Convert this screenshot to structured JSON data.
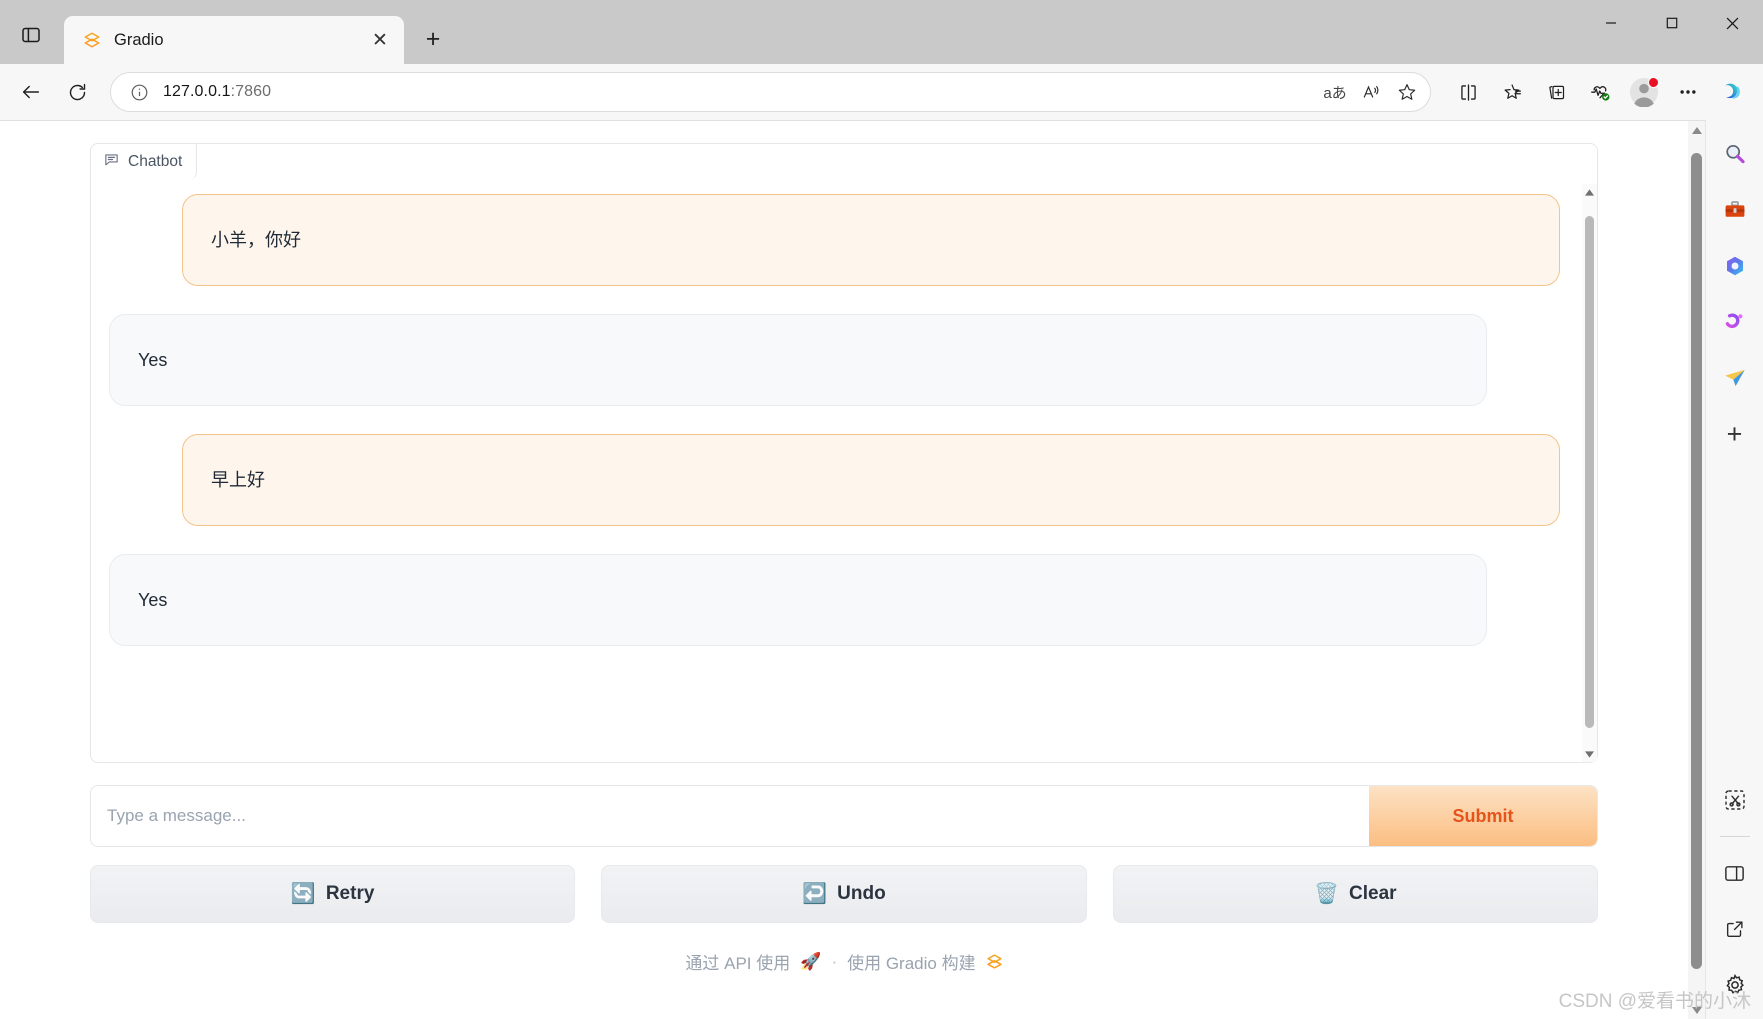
{
  "browser": {
    "tab": {
      "title": "Gradio",
      "favicon_icon": "gradio-logo-icon",
      "close_icon": "close-icon"
    },
    "new_tab_label": "+",
    "tab_sidebar_icon": "tab-sidebar-icon",
    "window_controls": {
      "minimize": "minimize-icon",
      "maximize": "maximize-icon",
      "close": "close-icon"
    },
    "nav": {
      "back_icon": "back-arrow-icon",
      "refresh_icon": "refresh-icon"
    },
    "omnibox": {
      "info_icon": "info-circle-icon",
      "url_host": "127.0.0.1",
      "url_port": ":7860",
      "actions": [
        {
          "name": "translate-icon",
          "glyph": "aあ"
        },
        {
          "name": "read-aloud-icon",
          "glyph": "A"
        },
        {
          "name": "favorite-star-icon",
          "glyph": "star"
        }
      ]
    },
    "toolbar_right": [
      {
        "name": "split-screen-icon"
      },
      {
        "name": "favorites-list-icon"
      },
      {
        "name": "collections-icon"
      },
      {
        "name": "browser-essentials-icon"
      },
      {
        "name": "profile-avatar"
      },
      {
        "name": "settings-and-more-icon"
      },
      {
        "name": "copilot-icon"
      }
    ],
    "rail": [
      {
        "name": "rail-search-icon",
        "glyph": "🔍"
      },
      {
        "name": "rail-tools-icon",
        "glyph": "🧰"
      },
      {
        "name": "rail-office-icon",
        "glyph": "🔷"
      },
      {
        "name": "rail-games-icon",
        "glyph": "🪄"
      },
      {
        "name": "rail-outlook-icon",
        "glyph": "📨"
      },
      {
        "name": "rail-add-icon",
        "glyph": "+"
      }
    ],
    "rail_bottom": [
      {
        "name": "rail-screenshot-icon",
        "glyph": "✂"
      },
      {
        "name": "rail-sidebar-toggle-icon",
        "glyph": "▯"
      },
      {
        "name": "rail-open-external-icon",
        "glyph": "↗"
      },
      {
        "name": "rail-settings-icon",
        "glyph": "⚙"
      }
    ]
  },
  "app": {
    "chatbot": {
      "label": "Chatbot",
      "label_icon": "chat-bubble-icon",
      "messages": [
        {
          "role": "user",
          "text": "小羊，你好"
        },
        {
          "role": "bot",
          "text": "Yes"
        },
        {
          "role": "user",
          "text": "早上好"
        },
        {
          "role": "bot",
          "text": "Yes"
        }
      ]
    },
    "input": {
      "value": "",
      "placeholder": "Type a message..."
    },
    "submit_label": "Submit",
    "actions": [
      {
        "name": "retry-button",
        "icon": "🔄",
        "label": "Retry"
      },
      {
        "name": "undo-button",
        "icon": "↩️",
        "label": "Undo"
      },
      {
        "name": "clear-button",
        "icon": "🗑️",
        "label": "Clear"
      }
    ],
    "footer": {
      "api_text": "通过 API 使用",
      "api_icon": "🚀",
      "separator": "·",
      "built_text": "使用 Gradio 构建",
      "built_icon": "gradio-logo-icon"
    }
  },
  "watermark": "CSDN @爱看书的小沐",
  "colors": {
    "accent_orange": "#e4541b",
    "user_bubble_bg": "#fef6ec",
    "user_bubble_border": "#f3c489",
    "bot_bubble_bg": "#f7f9fb"
  }
}
